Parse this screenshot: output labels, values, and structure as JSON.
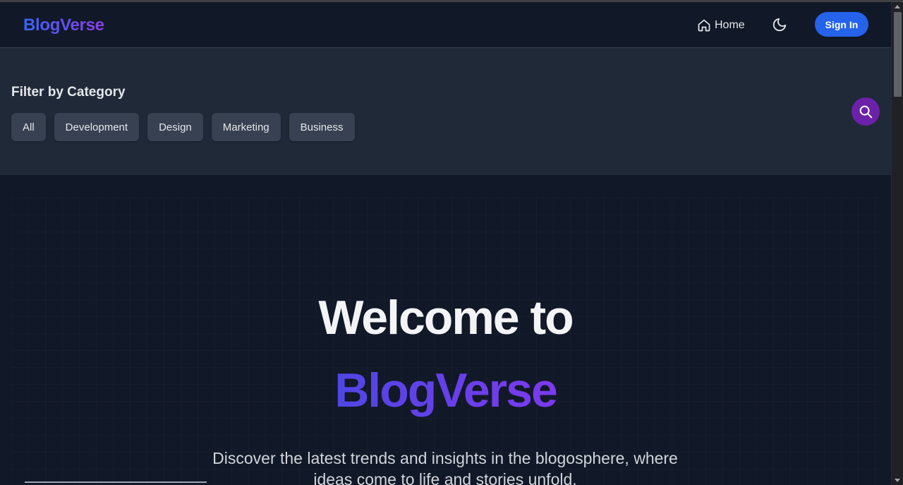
{
  "header": {
    "logo": "BlogVerse",
    "home_label": "Home",
    "home_icon": "home-icon",
    "theme_icon": "moon-icon",
    "signin_label": "Sign In"
  },
  "filter": {
    "title": "Filter by Category",
    "categories": [
      "All",
      "Development",
      "Design",
      "Marketing",
      "Business"
    ],
    "search_icon": "search-icon"
  },
  "hero": {
    "title": "Welcome to",
    "brand": "BlogVerse",
    "subtitle": "Discover the latest trends and insights in the blogosphere, where ideas come to life and stories unfold."
  },
  "colors": {
    "background": "#111827",
    "panel": "#1f2937",
    "accent_blue": "#2563eb",
    "accent_purple": "#6b21a8",
    "brand_gradient_start": "#4f46e5",
    "brand_gradient_end": "#7c3aed"
  }
}
